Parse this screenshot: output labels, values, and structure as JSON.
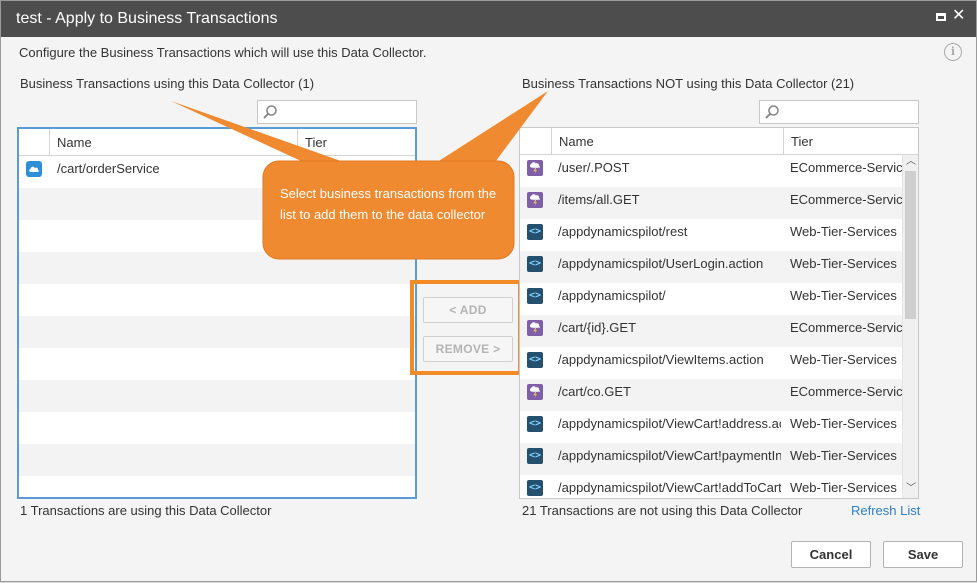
{
  "dialog": {
    "title": "test - Apply to Business Transactions",
    "description": "Configure the Business Transactions which will use this Data Collector."
  },
  "left": {
    "label": "Business Transactions using this Data Collector (1)",
    "search": {
      "value": "",
      "placeholder": ""
    },
    "columns": [
      "Name",
      "Tier"
    ],
    "rows": [
      {
        "icon": "cloud-icon",
        "name": "/cart/orderService",
        "tier": ""
      }
    ],
    "footer": "1 Transactions are using this Data Collector"
  },
  "right": {
    "label": "Business Transactions NOT using this Data Collector (21)",
    "search": {
      "value": "",
      "placeholder": ""
    },
    "columns": [
      "Name",
      "Tier"
    ],
    "rows": [
      {
        "icon": "php-icon",
        "name": "/user/.POST",
        "tier": "ECommerce-Services"
      },
      {
        "icon": "php-icon",
        "name": "/items/all.GET",
        "tier": "ECommerce-Services"
      },
      {
        "icon": "java-icon",
        "name": "/appdynamicspilot/rest",
        "tier": "Web-Tier-Services"
      },
      {
        "icon": "java-icon",
        "name": "/appdynamicspilot/UserLogin.action",
        "tier": "Web-Tier-Services"
      },
      {
        "icon": "java-icon",
        "name": "/appdynamicspilot/",
        "tier": "Web-Tier-Services"
      },
      {
        "icon": "php-icon",
        "name": "/cart/{id}.GET",
        "tier": "ECommerce-Services"
      },
      {
        "icon": "java-icon",
        "name": "/appdynamicspilot/ViewItems.action",
        "tier": "Web-Tier-Services"
      },
      {
        "icon": "php-icon",
        "name": "/cart/co.GET",
        "tier": "ECommerce-Services"
      },
      {
        "icon": "java-icon",
        "name": "/appdynamicspilot/ViewCart!address.action",
        "tier": "Web-Tier-Services"
      },
      {
        "icon": "java-icon",
        "name": "/appdynamicspilot/ViewCart!paymentInfo.action",
        "tier": "Web-Tier-Services"
      },
      {
        "icon": "java-icon",
        "name": "/appdynamicspilot/ViewCart!addToCart.action",
        "tier": "Web-Tier-Services"
      }
    ],
    "footer": "21 Transactions are not using this Data Collector",
    "refresh_label": "Refresh List"
  },
  "buttons": {
    "add_label": "< ADD",
    "remove_label": "REMOVE >",
    "cancel_label": "Cancel",
    "save_label": "Save"
  },
  "callout": {
    "text": "Select business transactions from the list to add them to the data collector"
  },
  "colors": {
    "titlebar": "#4d4d4d",
    "accent_orange": "#f28a26",
    "selected_border": "#5b9bd5",
    "link": "#2d7fc4"
  }
}
